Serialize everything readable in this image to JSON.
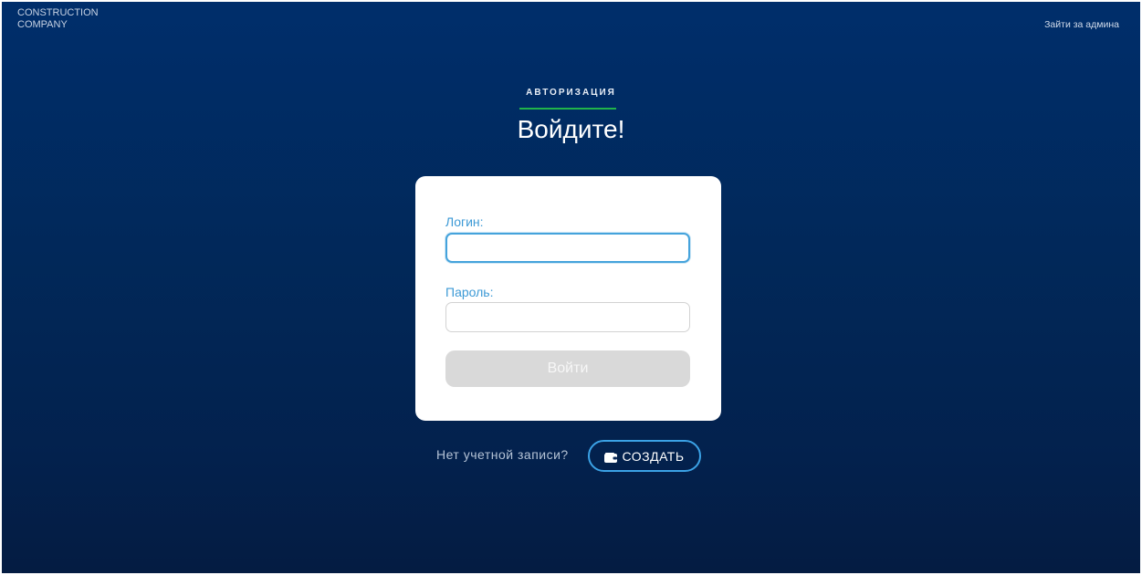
{
  "header": {
    "brand_line1": "CONSTRUCTION",
    "brand_line2": "COMPANY",
    "admin_link": "Зайти за админа"
  },
  "hero": {
    "eyebrow": "АВТОРИЗАЦИЯ",
    "title": "Войдите!",
    "accent_color": "#21b44a"
  },
  "form": {
    "login_label": "Логин:",
    "login_value": "",
    "password_label": "Пароль:",
    "password_value": "",
    "submit_label": "Войти"
  },
  "signup": {
    "prompt": "Нет учетной записи?",
    "button_label": "СОЗДАТЬ",
    "button_icon": "wallet-icon",
    "button_border_color": "#3ba2e6"
  }
}
